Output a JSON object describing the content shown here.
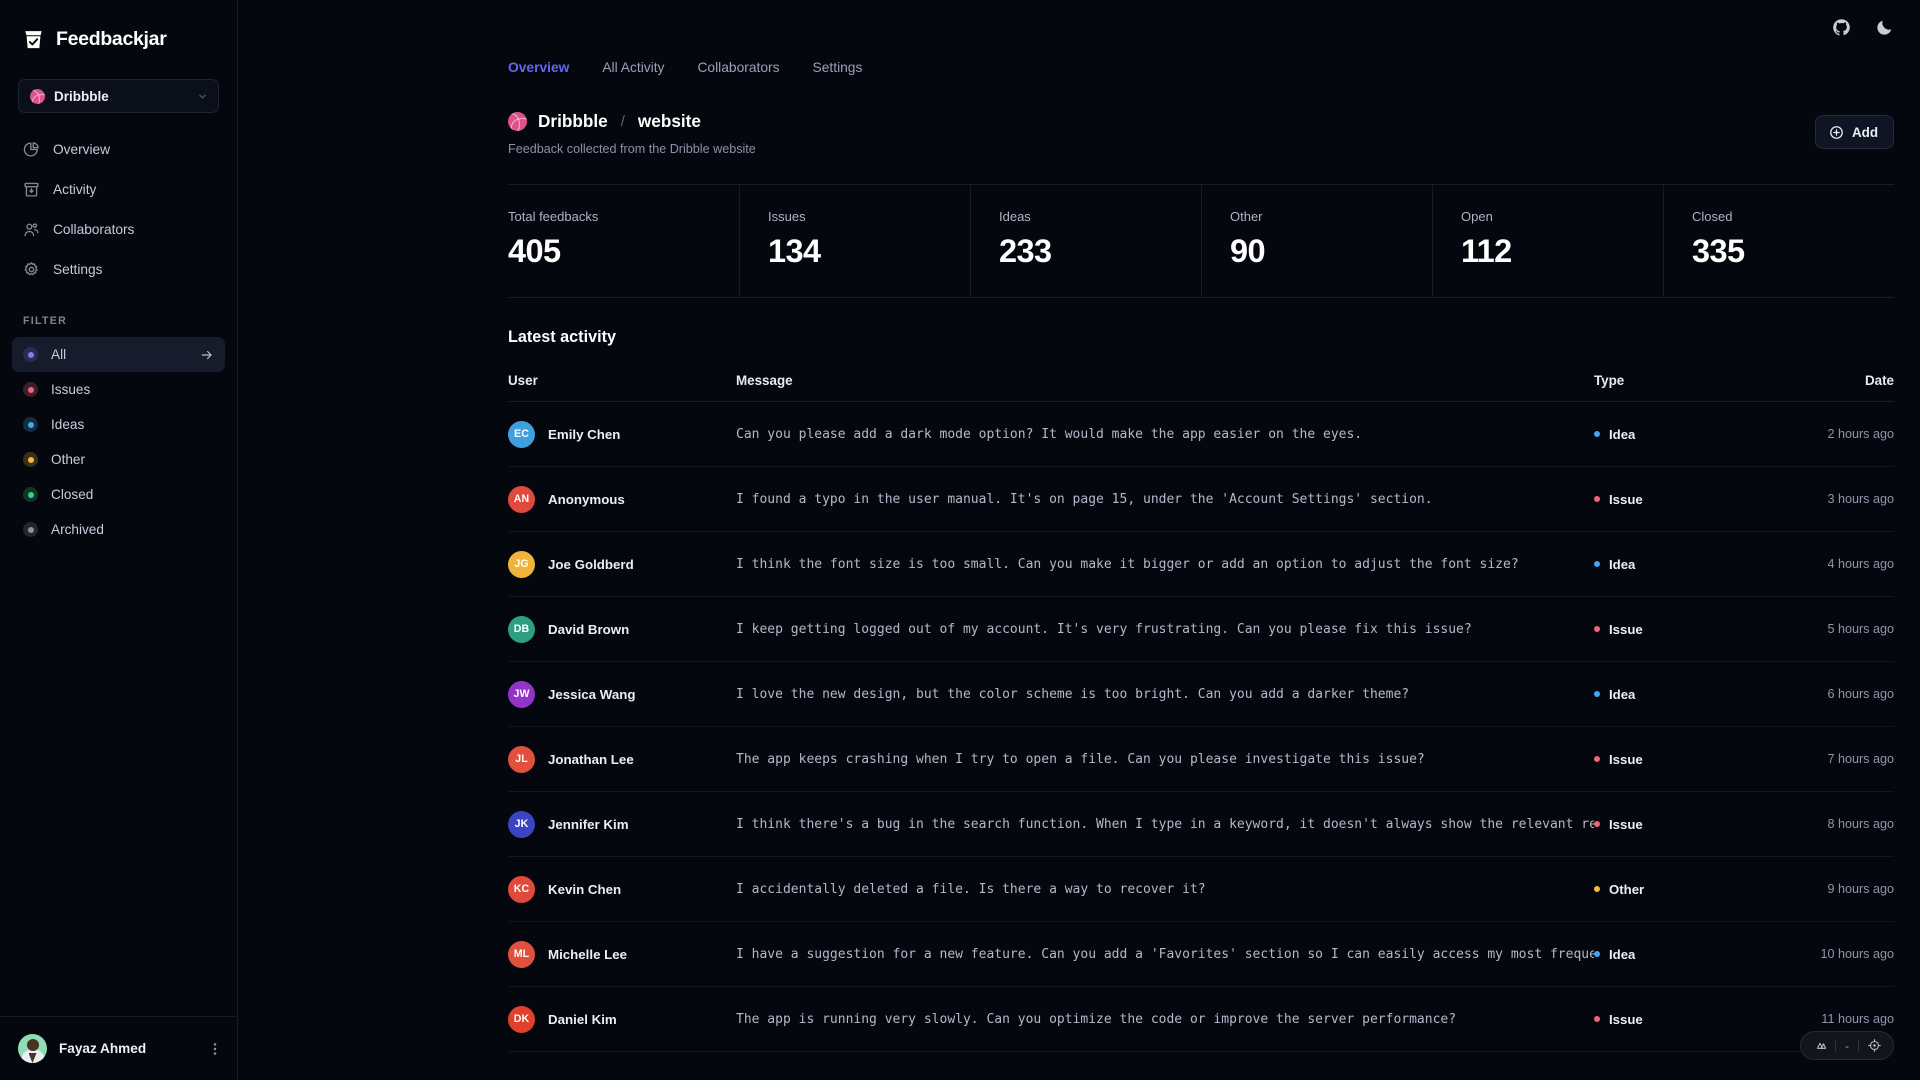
{
  "brand": {
    "name": "Feedbackjar",
    "logo_icon": "jar-check-icon"
  },
  "sidebar": {
    "project_selector": {
      "label": "Dribbble",
      "icon": "dribbble-icon",
      "chevron": "chevron-down-icon"
    },
    "nav": [
      {
        "label": "Overview",
        "icon": "pie-chart-icon"
      },
      {
        "label": "Activity",
        "icon": "archive-inbox-icon"
      },
      {
        "label": "Collaborators",
        "icon": "users-icon"
      },
      {
        "label": "Settings",
        "icon": "gear-icon"
      }
    ],
    "filter_heading": "FILTER",
    "filters": [
      {
        "label": "All",
        "color": "#7c7ff0",
        "active": true,
        "arrow_icon": "arrow-right-icon"
      },
      {
        "label": "Issues",
        "color": "#f2647a",
        "active": false
      },
      {
        "label": "Ideas",
        "color": "#3ea8f0",
        "active": false
      },
      {
        "label": "Other",
        "color": "#f2bc3e",
        "active": false
      },
      {
        "label": "Closed",
        "color": "#34d08a",
        "active": false
      },
      {
        "label": "Archived",
        "color": "#8b92a6",
        "active": false
      }
    ],
    "footer": {
      "user_name": "Fayaz Ahmed",
      "menu_icon": "kebab-menu-icon",
      "avatar": "user-avatar"
    }
  },
  "topbar": {
    "icons": [
      {
        "name": "github-icon"
      },
      {
        "name": "moon-dark-mode-icon"
      }
    ]
  },
  "tabs": [
    {
      "label": "Overview",
      "active": true
    },
    {
      "label": "All Activity",
      "active": false
    },
    {
      "label": "Collaborators",
      "active": false
    },
    {
      "label": "Settings",
      "active": false
    }
  ],
  "page": {
    "org": "Dribbble",
    "separator": "/",
    "project": "website",
    "subtitle": "Feedback collected from the Dribble website",
    "add_button": {
      "label": "Add",
      "icon": "plus-circle-icon"
    }
  },
  "stats": [
    {
      "label": "Total feedbacks",
      "value": "405"
    },
    {
      "label": "Issues",
      "value": "134"
    },
    {
      "label": "Ideas",
      "value": "233"
    },
    {
      "label": "Other",
      "value": "90"
    },
    {
      "label": "Open",
      "value": "112"
    },
    {
      "label": "Closed",
      "value": "335"
    }
  ],
  "activity": {
    "title": "Latest activity",
    "columns": {
      "user": "User",
      "message": "Message",
      "type": "Type",
      "date": "Date"
    },
    "rows": [
      {
        "initials": "EC",
        "avatar_color": "#3fa0e0",
        "name": "Emily Chen",
        "message": "Can you please add a dark mode option? It would make the app easier on the eyes.",
        "type": "Idea",
        "type_color": "#3ea8f0",
        "date": "2 hours ago"
      },
      {
        "initials": "AN",
        "avatar_color": "#e04a3c",
        "name": "Anonymous",
        "message": "I found a typo in the user manual. It's on page 15, under the 'Account Settings' section.",
        "type": "Issue",
        "type_color": "#f2647a",
        "date": "3 hours ago"
      },
      {
        "initials": "JG",
        "avatar_color": "#f0b43a",
        "name": "Joe Goldberd",
        "message": "I think the font size is too small. Can you make it bigger or add an option to adjust the font size?",
        "type": "Idea",
        "type_color": "#3ea8f0",
        "date": "4 hours ago"
      },
      {
        "initials": "DB",
        "avatar_color": "#2e9e84",
        "name": "David Brown",
        "message": "I keep getting logged out of my account. It's very frustrating. Can you please fix this issue?",
        "type": "Issue",
        "type_color": "#f2647a",
        "date": "5 hours ago"
      },
      {
        "initials": "JW",
        "avatar_color": "#9333c9",
        "name": "Jessica Wang",
        "message": "I love the new design, but the color scheme is too bright. Can you add a darker theme?",
        "type": "Idea",
        "type_color": "#3ea8f0",
        "date": "6 hours ago"
      },
      {
        "initials": "JL",
        "avatar_color": "#e0503c",
        "name": "Jonathan Lee",
        "message": "The app keeps crashing when I try to open a file. Can you please investigate this issue?",
        "type": "Issue",
        "type_color": "#f2647a",
        "date": "7 hours ago"
      },
      {
        "initials": "JK",
        "avatar_color": "#3b45c4",
        "name": "Jennifer Kim",
        "message": "I think there's a bug in the search function. When I type in a keyword, it doesn't always show the relevant results.",
        "type": "Issue",
        "type_color": "#f2647a",
        "date": "8 hours ago"
      },
      {
        "initials": "KC",
        "avatar_color": "#e04a3c",
        "name": "Kevin Chen",
        "message": "I accidentally deleted a file. Is there a way to recover it?",
        "type": "Other",
        "type_color": "#f2bc3e",
        "date": "9 hours ago"
      },
      {
        "initials": "ML",
        "avatar_color": "#e0503c",
        "name": "Michelle Lee",
        "message": "I have a suggestion for a new feature. Can you add a 'Favorites' section so I can easily access my most frequently used files?",
        "type": "Idea",
        "type_color": "#3ea8f0",
        "date": "10 hours ago"
      },
      {
        "initials": "DK",
        "avatar_color": "#e0402c",
        "name": "Daniel Kim",
        "message": "The app is running very slowly. Can you optimize the code or improve the server performance?",
        "type": "Issue",
        "type_color": "#f2647a",
        "date": "11 hours ago"
      }
    ]
  },
  "devbar": {
    "logo_icon": "vercel-triangle-icon",
    "dash": "-",
    "target_icon": "crosshair-icon"
  }
}
